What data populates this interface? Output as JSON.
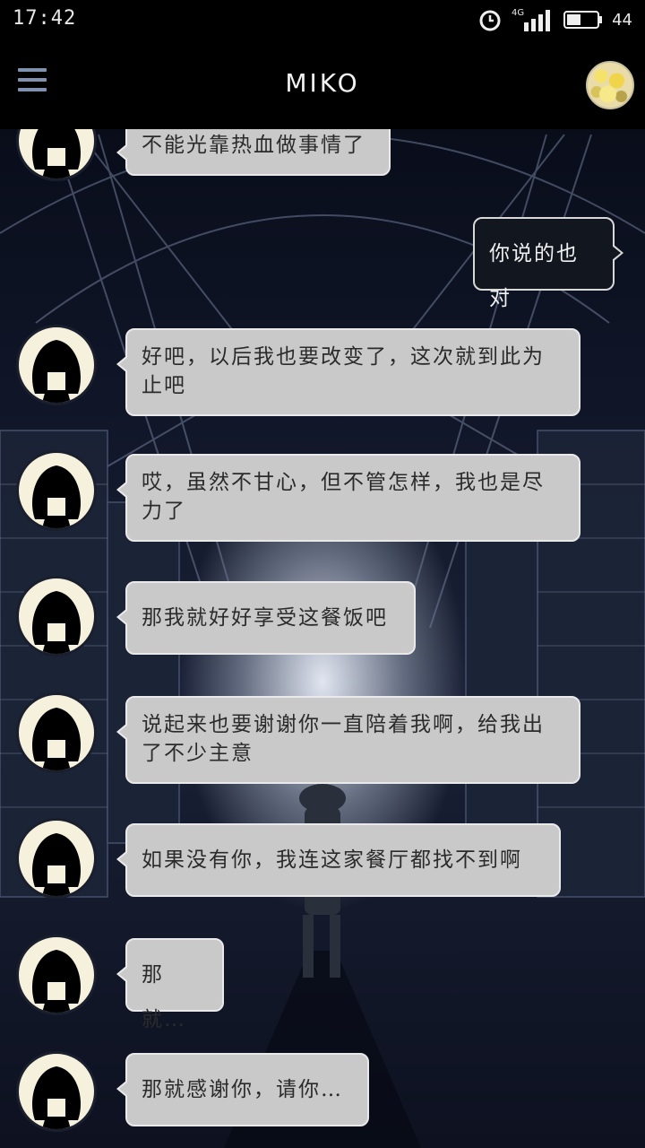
{
  "status_bar": {
    "time": "17:42",
    "network": "4G",
    "battery": "44"
  },
  "header": {
    "title": "MIKO"
  },
  "messages": [
    {
      "sender": "miko",
      "text": "不能光靠热血做事情了"
    },
    {
      "sender": "me",
      "text": "你说的也对"
    },
    {
      "sender": "miko",
      "text": "好吧，以后我也要改变了，这次就到此为止吧"
    },
    {
      "sender": "miko",
      "text": "哎，虽然不甘心，但不管怎样，我也是尽力了"
    },
    {
      "sender": "miko",
      "text": "那我就好好享受这餐饭吧"
    },
    {
      "sender": "miko",
      "text": "说起来也要谢谢你一直陪着我啊，给我出了不少主意"
    },
    {
      "sender": "miko",
      "text": "如果没有你，我连这家餐厅都找不到啊"
    },
    {
      "sender": "miko",
      "text": "那就…"
    },
    {
      "sender": "miko",
      "text": "那就感谢你，请你…"
    }
  ]
}
